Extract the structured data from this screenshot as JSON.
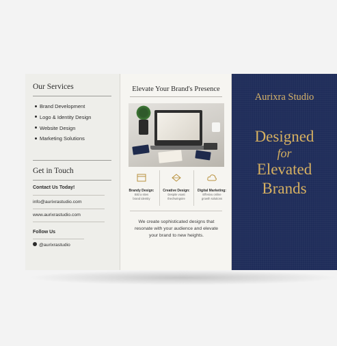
{
  "services": {
    "heading": "Our Services",
    "items": [
      "Brand Development",
      "Logo & Identity Design",
      "Website Design",
      "Marketing Solutions"
    ]
  },
  "contact": {
    "heading": "Get in Touch",
    "cta": "Contact Us Today!",
    "email": "info@aurixrastudio.com",
    "website": "www.aurixrastudio.com",
    "follow_label": "Follow Us",
    "social": "@aurixrastudio"
  },
  "middle": {
    "heading": "Elevate Your Brand's Presence",
    "features": [
      {
        "title": "Brandy Design:",
        "desc1": "Bild a sites",
        "desc2": "brand identity",
        "icon": "browser-icon"
      },
      {
        "title": "Creative Design:",
        "desc1": "Despite voast",
        "desc2": "thechwingsire",
        "icon": "diamond-icon"
      },
      {
        "title": "Digital Marketing:",
        "desc1": "Effesivu online",
        "desc2": "growth solutions",
        "icon": "cloud-icon"
      }
    ],
    "intro": "We create sophisticated designs that resonate with your audience and elevate your brand to new heights."
  },
  "cover": {
    "studio": "Aurixra Studio",
    "tag_line1": "Designed",
    "tag_line2": "for",
    "tag_line3": "Elevated",
    "tag_line4": "Brands"
  },
  "colors": {
    "navy": "#1f2d5a",
    "gold": "#d6b061",
    "paper": "#eeeeea"
  }
}
